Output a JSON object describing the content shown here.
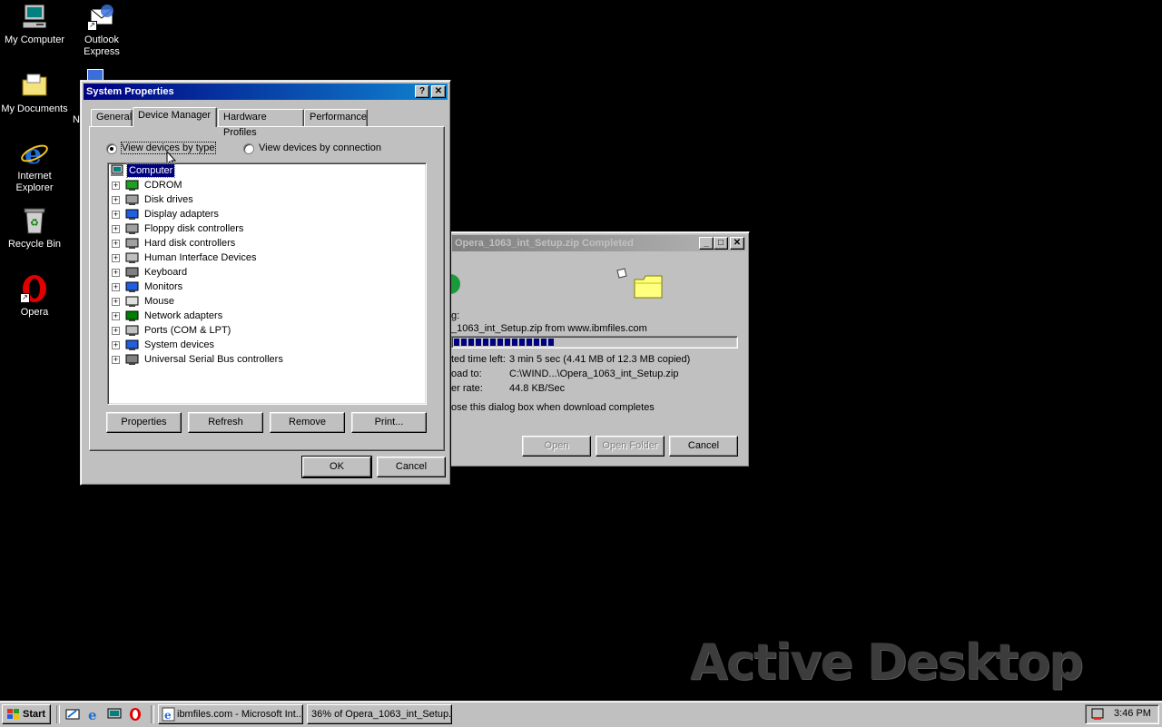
{
  "desktop": {
    "icons": [
      {
        "label": "My Computer"
      },
      {
        "label": "Outlook Express"
      },
      {
        "label": "My Documents"
      },
      {
        "label": "Internet Explorer"
      },
      {
        "label": "Recycle Bin"
      },
      {
        "label": "Opera"
      }
    ],
    "watermark": "Active Desktop",
    "hidden_label_fragment": "N"
  },
  "system_properties": {
    "title": "System Properties",
    "help_btn": "?",
    "close_btn": "✕",
    "tabs": [
      {
        "label": "General"
      },
      {
        "label": "Device Manager"
      },
      {
        "label": "Hardware Profiles"
      },
      {
        "label": "Performance"
      }
    ],
    "radio_by_type": "View devices by type",
    "radio_by_connection": "View devices by connection",
    "tree_root": "Computer",
    "tree_items": [
      {
        "label": "CDROM"
      },
      {
        "label": "Disk drives"
      },
      {
        "label": "Display adapters"
      },
      {
        "label": "Floppy disk controllers"
      },
      {
        "label": "Hard disk controllers"
      },
      {
        "label": "Human Interface Devices"
      },
      {
        "label": "Keyboard"
      },
      {
        "label": "Monitors"
      },
      {
        "label": "Mouse"
      },
      {
        "label": "Network adapters"
      },
      {
        "label": "Ports (COM & LPT)"
      },
      {
        "label": "System devices"
      },
      {
        "label": "Universal Serial Bus controllers"
      }
    ],
    "expander_glyph": "+",
    "buttons": {
      "properties": "Properties",
      "refresh": "Refresh",
      "remove": "Remove",
      "print": "Print..."
    },
    "ok": "OK",
    "cancel": "Cancel"
  },
  "download_dialog": {
    "title": "Opera_1063_int_Setup.zip Completed",
    "min_btn": "_",
    "max_btn": "□",
    "close_btn": "✕",
    "source_label": "g:",
    "source_value": "_1063_int_Setup.zip from www.ibmfiles.com",
    "progress": 0.36,
    "time_left_label": "ted time left:",
    "time_left_value": "3 min 5 sec (4.41 MB of 12.3 MB copied)",
    "download_to_label": "oad to:",
    "download_to_value": "C:\\WIND...\\Opera_1063_int_Setup.zip",
    "transfer_rate_label": "er rate:",
    "transfer_rate_value": "44.8 KB/Sec",
    "close_checkbox_label": "ose this dialog box when download completes",
    "open": "Open",
    "open_folder": "Open Folder",
    "cancel": "Cancel"
  },
  "taskbar": {
    "start": "Start",
    "tasks": [
      {
        "label": "ibmfiles.com - Microsoft Int..."
      },
      {
        "label": "36% of Opera_1063_int_Setup..."
      }
    ],
    "clock": "3:46 PM"
  },
  "colors": {
    "title_active": "#000080",
    "selection": "#000080",
    "progress": "#000080",
    "face": "#c0c0c0"
  }
}
